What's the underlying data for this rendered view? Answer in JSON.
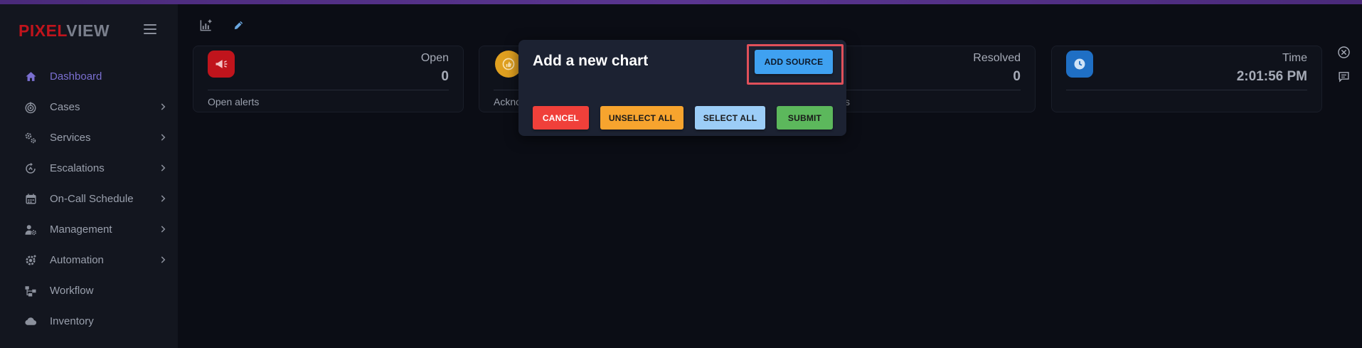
{
  "app": {
    "logo_part1": "PIXEL",
    "logo_part2": "VIEW"
  },
  "sidebar": {
    "items": [
      {
        "label": "Dashboard",
        "icon": "home-icon",
        "active": true,
        "has_chevron": false
      },
      {
        "label": "Cases",
        "icon": "target-icon",
        "active": false,
        "has_chevron": true
      },
      {
        "label": "Services",
        "icon": "gears-icon",
        "active": false,
        "has_chevron": true
      },
      {
        "label": "Escalations",
        "icon": "escalation-icon",
        "active": false,
        "has_chevron": true
      },
      {
        "label": "On-Call Schedule",
        "icon": "calendar-icon",
        "active": false,
        "has_chevron": true
      },
      {
        "label": "Management",
        "icon": "user-gear-icon",
        "active": false,
        "has_chevron": true
      },
      {
        "label": "Automation",
        "icon": "gear-icon",
        "active": false,
        "has_chevron": true
      },
      {
        "label": "Workflow",
        "icon": "workflow-icon",
        "active": false,
        "has_chevron": false
      },
      {
        "label": "Inventory",
        "icon": "cloud-icon",
        "active": false,
        "has_chevron": false
      }
    ]
  },
  "cards": [
    {
      "label": "Open",
      "value": "0",
      "footer": "Open alerts",
      "icon": "megaphone-icon",
      "color": "#c0141c"
    },
    {
      "label": "",
      "value": "",
      "footer": "Ackno",
      "icon": "thumbs-up-icon",
      "color": "#e0a020"
    },
    {
      "label": "Resolved",
      "value": "0",
      "footer": "s",
      "icon": "",
      "color": ""
    },
    {
      "label": "Time",
      "value": "2:01:56 PM",
      "footer": "",
      "icon": "clock-icon",
      "color": "#1f6fc4"
    }
  ],
  "modal": {
    "title": "Add a new chart",
    "add_source": "ADD SOURCE",
    "cancel": "CANCEL",
    "unselect_all": "UNSELECT ALL",
    "select_all": "SELECT ALL",
    "submit": "SUBMIT"
  },
  "colors": {
    "accent": "#7a6fd0",
    "cancel": "#f0403a",
    "unselect": "#f7a42e",
    "select": "#9ccdf7",
    "submit": "#5cb85c",
    "add_source": "#3fa1f1",
    "highlight": "#e0505a"
  }
}
